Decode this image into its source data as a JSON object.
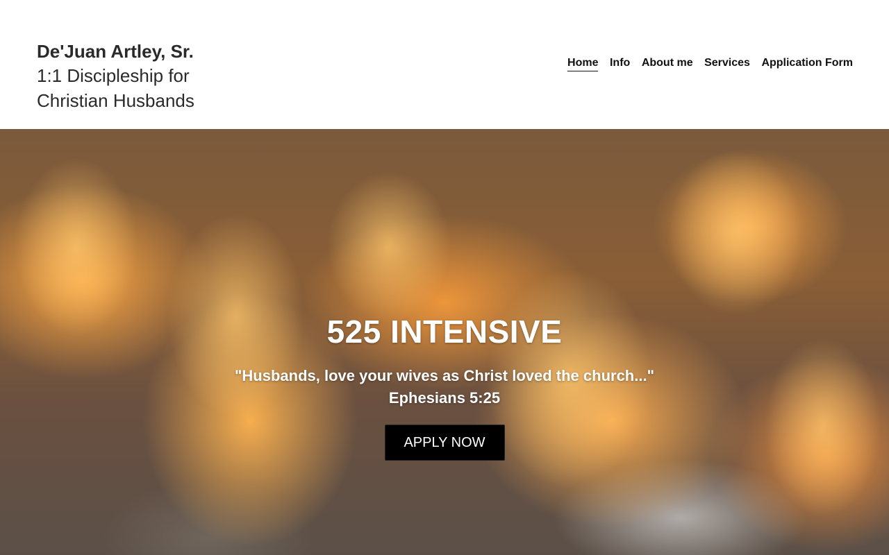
{
  "header": {
    "brand_name": "De'Juan Artley, Sr.",
    "brand_tagline": "1:1 Discipleship for Christian Husbands",
    "nav": [
      {
        "label": "Home",
        "active": true
      },
      {
        "label": "Info",
        "active": false
      },
      {
        "label": "About me",
        "active": false
      },
      {
        "label": "Services",
        "active": false
      },
      {
        "label": "Application Form",
        "active": false
      }
    ]
  },
  "hero": {
    "background": "flames-over-water-photo",
    "title": "525 INTENSIVE",
    "quote": "\"Husbands, love your wives as Christ loved the church...\"",
    "reference": "Ephesians 5:25",
    "cta_label": "APPLY NOW"
  },
  "colors": {
    "header_bg": "#ffffff",
    "text_dark": "#2a2a2a",
    "button_bg": "#000000",
    "hero_text": "#ffffff",
    "flame_orange": "#f0902a"
  }
}
